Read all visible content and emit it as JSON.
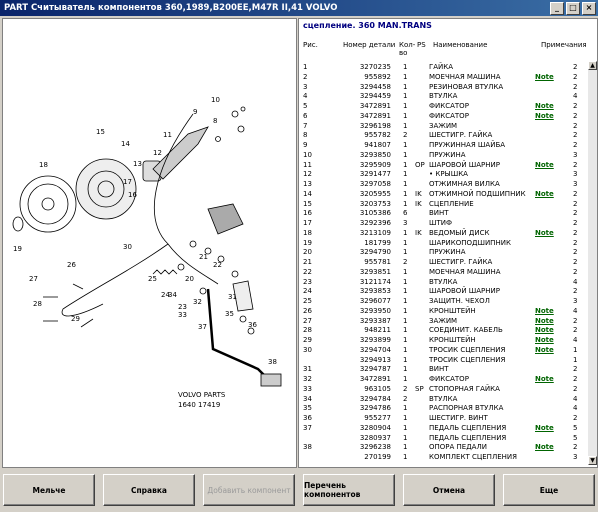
{
  "window": {
    "title": "PART Считыватель компонентов 360,1989,B200EE,M47R II,41 VOLVO"
  },
  "diagram": {
    "labels": [
      "10",
      "9",
      "8",
      "11",
      "12",
      "15",
      "14",
      "13",
      "17",
      "16",
      "18",
      "19",
      "20",
      "21",
      "22",
      "26",
      "27",
      "28",
      "25",
      "24",
      "23",
      "29",
      "31",
      "32",
      "33",
      "34",
      "35",
      "36",
      "37",
      "38",
      "30"
    ],
    "stamp_line1": "VOLVO PARTS",
    "stamp_line2": "1640    17419"
  },
  "parts_panel": {
    "title": "сцепление. 360 MAN.TRANS",
    "headers": {
      "ref": "Рис.",
      "part": "Номер детали",
      "qty": "Кол-во",
      "ps": "PS",
      "name": "Наименование",
      "notes": "Примечания"
    },
    "rows": [
      {
        "ref": "1",
        "part": "3270235",
        "qty": "1",
        "ps": "",
        "name": "ГАЙКА",
        "note": "",
        "n": "2"
      },
      {
        "ref": "2",
        "part": "955892",
        "qty": "1",
        "ps": "",
        "name": "МОЕЧНАЯ МАШИНА",
        "note": "Note",
        "n": "2"
      },
      {
        "ref": "3",
        "part": "3294458",
        "qty": "1",
        "ps": "",
        "name": "РЕЗИНОВАЯ ВТУЛКА",
        "note": "",
        "n": "2"
      },
      {
        "ref": "4",
        "part": "3294459",
        "qty": "1",
        "ps": "",
        "name": "ВТУЛКА",
        "note": "",
        "n": "4"
      },
      {
        "ref": "5",
        "part": "3472891",
        "qty": "1",
        "ps": "",
        "name": "ФИКСАТОР",
        "note": "Note",
        "n": "2"
      },
      {
        "ref": "6",
        "part": "3472891",
        "qty": "1",
        "ps": "",
        "name": "ФИКСАТОР",
        "note": "Note",
        "n": "2"
      },
      {
        "ref": "7",
        "part": "3296198",
        "qty": "1",
        "ps": "",
        "name": "ЗАЖИМ",
        "note": "",
        "n": "2"
      },
      {
        "ref": "8",
        "part": "955782",
        "qty": "2",
        "ps": "",
        "name": "ШЕСТИГР. ГАЙКА",
        "note": "",
        "n": "2"
      },
      {
        "ref": "9",
        "part": "941807",
        "qty": "1",
        "ps": "",
        "name": "ПРУЖИННАЯ ШАЙБА",
        "note": "",
        "n": "2"
      },
      {
        "ref": "10",
        "part": "3293850",
        "qty": "1",
        "ps": "",
        "name": "ПРУЖИНА",
        "note": "",
        "n": "3"
      },
      {
        "ref": "11",
        "part": "3295909",
        "qty": "1",
        "ps": "OP",
        "name": "ШАРОВОЙ ШАРНИР",
        "note": "Note",
        "n": "2"
      },
      {
        "ref": "12",
        "part": "3291477",
        "qty": "1",
        "ps": "",
        "name": "• КРЫШКА",
        "note": "",
        "n": "3"
      },
      {
        "ref": "13",
        "part": "3297058",
        "qty": "1",
        "ps": "",
        "name": "ОТЖИМНАЯ ВИЛКА",
        "note": "",
        "n": "3"
      },
      {
        "ref": "14",
        "part": "3205955",
        "qty": "1",
        "ps": "IK",
        "name": "ОТЖИМНОЙ ПОДШИПНИК",
        "note": "Note",
        "n": "2"
      },
      {
        "ref": "15",
        "part": "3203753",
        "qty": "1",
        "ps": "IK",
        "name": "СЦЕПЛЕНИЕ",
        "note": "",
        "n": "2"
      },
      {
        "ref": "16",
        "part": "3105386",
        "qty": "6",
        "ps": "",
        "name": "ВИНТ",
        "note": "",
        "n": "2"
      },
      {
        "ref": "17",
        "part": "3292396",
        "qty": "3",
        "ps": "",
        "name": "ШТИФ",
        "note": "",
        "n": "2"
      },
      {
        "ref": "18",
        "part": "3213109",
        "qty": "1",
        "ps": "IK",
        "name": "ВЕДОМЫЙ ДИСК",
        "note": "Note",
        "n": "2"
      },
      {
        "ref": "19",
        "part": "181799",
        "qty": "1",
        "ps": "",
        "name": "ШАРИКОПОДШИПНИК",
        "note": "",
        "n": "2"
      },
      {
        "ref": "20",
        "part": "3294790",
        "qty": "1",
        "ps": "",
        "name": "ПРУЖИНА",
        "note": "",
        "n": "2"
      },
      {
        "ref": "21",
        "part": "955781",
        "qty": "2",
        "ps": "",
        "name": "ШЕСТИГР. ГАЙКА",
        "note": "",
        "n": "2"
      },
      {
        "ref": "22",
        "part": "3293851",
        "qty": "1",
        "ps": "",
        "name": "МОЕЧНАЯ МАШИНА",
        "note": "",
        "n": "2"
      },
      {
        "ref": "23",
        "part": "3121174",
        "qty": "1",
        "ps": "",
        "name": "ВТУЛКА",
        "note": "",
        "n": "4"
      },
      {
        "ref": "24",
        "part": "3293853",
        "qty": "1",
        "ps": "",
        "name": "ШАРОВОЙ ШАРНИР",
        "note": "",
        "n": "2"
      },
      {
        "ref": "25",
        "part": "3296077",
        "qty": "1",
        "ps": "",
        "name": "ЗАЩИТН. ЧЕХОЛ",
        "note": "",
        "n": "3"
      },
      {
        "ref": "26",
        "part": "3293950",
        "qty": "1",
        "ps": "",
        "name": "КРОНШТЕЙН",
        "note": "Note",
        "n": "4"
      },
      {
        "ref": "27",
        "part": "3293387",
        "qty": "1",
        "ps": "",
        "name": "ЗАЖИМ",
        "note": "Note",
        "n": "2"
      },
      {
        "ref": "28",
        "part": "948211",
        "qty": "1",
        "ps": "",
        "name": "СОЕДИНИТ. КАБЕЛЬ",
        "note": "Note",
        "n": "2"
      },
      {
        "ref": "29",
        "part": "3293899",
        "qty": "1",
        "ps": "",
        "name": "КРОНШТЕЙН",
        "note": "Note",
        "n": "4"
      },
      {
        "ref": "30",
        "part": "3294704",
        "qty": "1",
        "ps": "",
        "name": "ТРОСИК СЦЕПЛЕНИЯ",
        "note": "Note",
        "n": "1"
      },
      {
        "ref": "",
        "part": "3294913",
        "qty": "1",
        "ps": "",
        "name": "ТРОСИК СЦЕПЛЕНИЯ",
        "note": "",
        "n": "1"
      },
      {
        "ref": "31",
        "part": "3294787",
        "qty": "1",
        "ps": "",
        "name": "ВИНТ",
        "note": "",
        "n": "2"
      },
      {
        "ref": "32",
        "part": "3472891",
        "qty": "1",
        "ps": "",
        "name": "ФИКСАТОР",
        "note": "Note",
        "n": "2"
      },
      {
        "ref": "33",
        "part": "963105",
        "qty": "2",
        "ps": "SP",
        "name": "СТОПОРНАЯ ГАЙКА",
        "note": "",
        "n": "2"
      },
      {
        "ref": "34",
        "part": "3294784",
        "qty": "2",
        "ps": "",
        "name": "ВТУЛКА",
        "note": "",
        "n": "4"
      },
      {
        "ref": "35",
        "part": "3294786",
        "qty": "1",
        "ps": "",
        "name": "РАСПОРНАЯ ВТУЛКА",
        "note": "",
        "n": "4"
      },
      {
        "ref": "36",
        "part": "955277",
        "qty": "1",
        "ps": "",
        "name": "ШЕСТИГР. ВИНТ",
        "note": "",
        "n": "2"
      },
      {
        "ref": "37",
        "part": "3280904",
        "qty": "1",
        "ps": "",
        "name": "ПЕДАЛЬ СЦЕПЛЕНИЯ",
        "note": "Note",
        "n": "5"
      },
      {
        "ref": "",
        "part": "3280937",
        "qty": "1",
        "ps": "",
        "name": "ПЕДАЛЬ СЦЕПЛЕНИЯ",
        "note": "",
        "n": "5"
      },
      {
        "ref": "38",
        "part": "3296238",
        "qty": "1",
        "ps": "",
        "name": "ОПОРА ПЕДАЛИ",
        "note": "Note",
        "n": "2"
      },
      {
        "ref": "",
        "part": "270199",
        "qty": "1",
        "ps": "",
        "name": "КОМПЛЕКТ СЦЕПЛЕНИЯ",
        "note": "",
        "n": "3"
      }
    ]
  },
  "buttons": {
    "smaller": "Мельче",
    "help": "Справка",
    "add": "Добавить компонент",
    "list": "Перечень компонентов",
    "cancel": "Отмена",
    "more": "Еще"
  }
}
